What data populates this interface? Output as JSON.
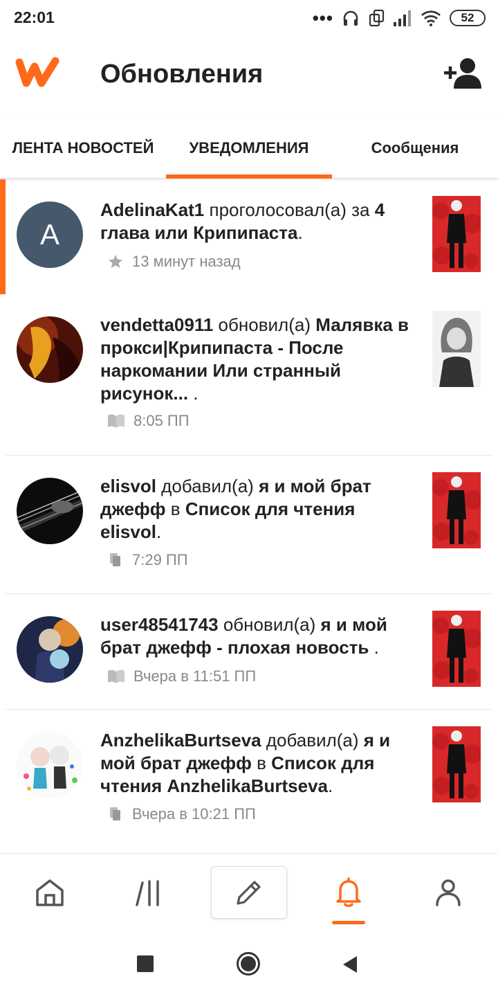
{
  "status_bar": {
    "time": "22:01",
    "battery": "52"
  },
  "header": {
    "title": "Обновления"
  },
  "tabs": [
    {
      "label": "ЛЕНТА НОВОСТЕЙ",
      "active": false
    },
    {
      "label": "УВЕДОМЛЕНИЯ",
      "active": true
    },
    {
      "label": "Сообщения",
      "active": false
    }
  ],
  "colors": {
    "accent": "#ff6a1a",
    "avatar_letter_bg": "#46586b",
    "cover_red": "#d9282a"
  },
  "notifications": [
    {
      "user": "AdelinaKat1",
      "action": " проголосовал(а) за ",
      "target": "4 глава или Крипипаста",
      "tail": ".",
      "time": "13 минут назад",
      "icon": "star-icon",
      "avatar_letter": "A",
      "unread": true
    },
    {
      "user": "vendetta0911",
      "action": " обновил(а) ",
      "target": "Малявка в прокси|Крипипаста - После наркомании Или странный рисунок...",
      "tail": " .",
      "time": "8:05 ПП",
      "icon": "book-icon",
      "unread": false
    },
    {
      "user": "elisvol",
      "action": " добавил(а) ",
      "target": "я и мой брат джефф",
      "mid": " в ",
      "target2": "Список для чтения elisvol",
      "tail": ".",
      "time": "7:29 ПП",
      "icon": "copy-icon",
      "unread": false
    },
    {
      "user": "user48541743",
      "action": " обновил(а) ",
      "target": "я и мой брат джефф - плохая новость",
      "tail": " .",
      "time": "Вчера в 11:51 ПП",
      "icon": "book-icon",
      "unread": false
    },
    {
      "user": "AnzhelikaBurtseva",
      "action": " добавил(а) ",
      "target": "я и мой брат джефф",
      "mid": " в ",
      "target2": "Список для чтения AnzhelikaBurtseva",
      "tail": ".",
      "time": "Вчера в 10:21 ПП",
      "icon": "copy-icon",
      "unread": false
    }
  ],
  "bottom_nav": [
    "home-icon",
    "library-icon",
    "write-icon",
    "notifications-icon",
    "profile-icon"
  ]
}
